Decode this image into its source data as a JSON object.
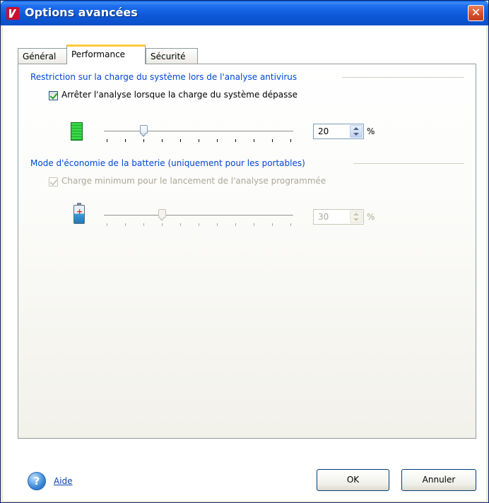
{
  "window": {
    "title": "Options avancées",
    "close_glyph": "✕",
    "icon": "kaspersky-logo-icon"
  },
  "tabs": [
    {
      "label": "Général",
      "active": false
    },
    {
      "label": "Performance",
      "active": true
    },
    {
      "label": "Sécurité",
      "active": false
    }
  ],
  "group1": {
    "heading": "Restriction sur la charge du système lors de l'analyse antivirus",
    "checkbox_label": "Arrêter l'analyse lorsque la charge du système dépasse",
    "checked": true,
    "slider_fraction": 0.2,
    "value": "20",
    "unit": "%",
    "icon": "cpu-load-gauge-icon"
  },
  "group2": {
    "heading": "Mode d'économie de la batterie (uniquement pour les portables)",
    "checkbox_label": "Charge minimum pour le lancement de l'analyse programmée",
    "checked": true,
    "disabled": true,
    "slider_fraction": 0.3,
    "value": "30",
    "unit": "%",
    "icon": "battery-icon"
  },
  "footer": {
    "help_label": "Aide",
    "help_glyph": "?",
    "ok_label": "OK",
    "cancel_label": "Annuler"
  },
  "colors": {
    "title_bar": "#0b4fc8",
    "group_heading": "#0046d5",
    "active_tab_highlight": "#ffc83c",
    "disabled_text": "#aca899"
  }
}
